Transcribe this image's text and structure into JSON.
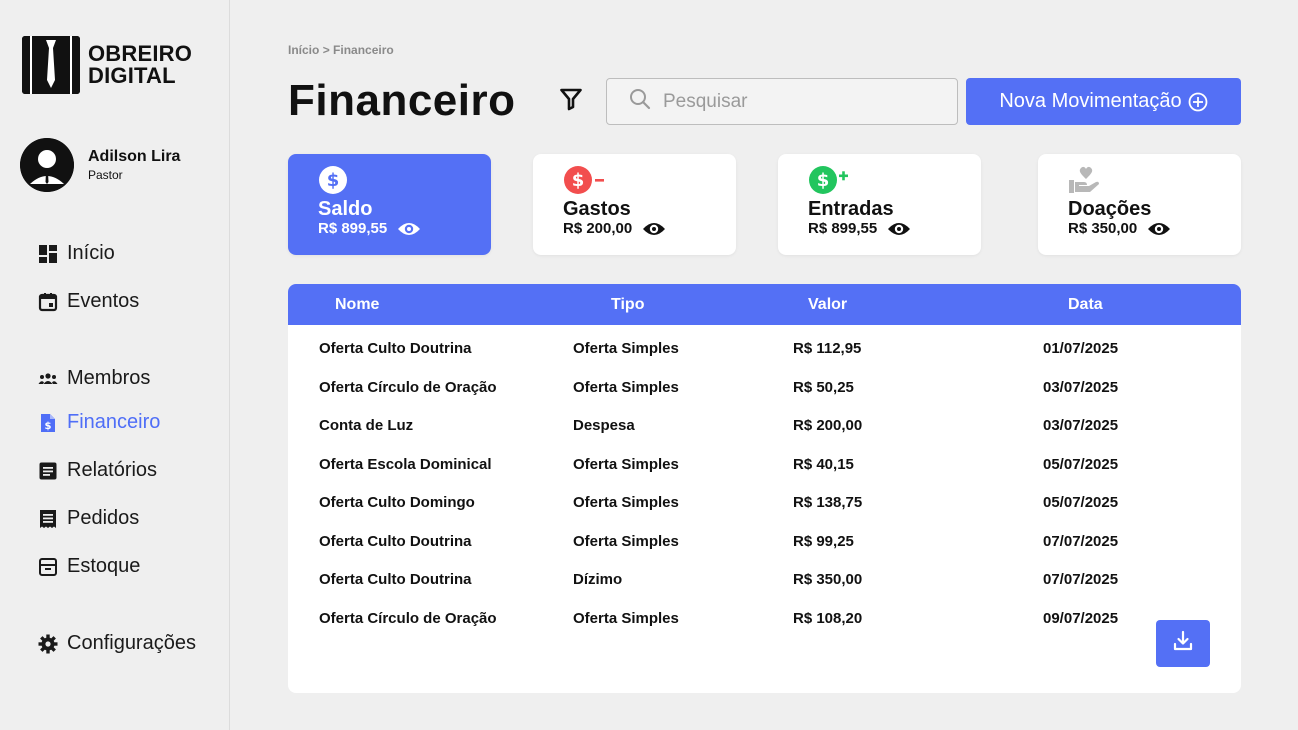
{
  "app": {
    "logo_line1": "OBREIRO",
    "logo_line2": "DIGITAL"
  },
  "user": {
    "name": "Adilson Lira",
    "role": "Pastor"
  },
  "sidebar": {
    "items": [
      {
        "label": "Início",
        "icon": "dashboard-icon"
      },
      {
        "label": "Eventos",
        "icon": "calendar-icon"
      },
      {
        "label": "Membros",
        "icon": "users-icon"
      },
      {
        "label": "Financeiro",
        "icon": "finance-doc-icon",
        "active": true
      },
      {
        "label": "Relatórios",
        "icon": "report-icon"
      },
      {
        "label": "Pedidos",
        "icon": "receipt-icon"
      },
      {
        "label": "Estoque",
        "icon": "archive-icon"
      },
      {
        "label": "Configurações",
        "icon": "gear-icon"
      }
    ]
  },
  "breadcrumb": {
    "home": "Início",
    "separator": ">",
    "current": "Financeiro"
  },
  "page": {
    "title": "Financeiro"
  },
  "search": {
    "placeholder": "Pesquisar",
    "value": ""
  },
  "actions": {
    "new_label": "Nova Movimentação"
  },
  "cards": [
    {
      "label": "Saldo",
      "value": "R$ 899,55",
      "icon": "dollar-icon"
    },
    {
      "label": "Gastos",
      "value": "R$ 200,00",
      "icon": "dollar-minus-icon"
    },
    {
      "label": "Entradas",
      "value": "R$ 899,55",
      "icon": "dollar-plus-icon"
    },
    {
      "label": "Doações",
      "value": "R$ 350,00",
      "icon": "donation-hand-icon"
    }
  ],
  "table": {
    "headers": [
      "Nome",
      "Tipo",
      "Valor",
      "Data"
    ],
    "rows": [
      [
        "Oferta Culto Doutrina",
        "Oferta Simples",
        "R$ 112,95",
        "01/07/2025"
      ],
      [
        "Oferta Círculo de Oração",
        "Oferta Simples",
        "R$ 50,25",
        "03/07/2025"
      ],
      [
        "Conta de Luz",
        "Despesa",
        "R$ 200,00",
        "03/07/2025"
      ],
      [
        "Oferta Escola Dominical",
        "Oferta Simples",
        "R$ 40,15",
        "05/07/2025"
      ],
      [
        "Oferta Culto Domingo",
        "Oferta Simples",
        "R$ 138,75",
        "05/07/2025"
      ],
      [
        "Oferta Culto Doutrina",
        "Oferta Simples",
        "R$ 99,25",
        "07/07/2025"
      ],
      [
        "Oferta Culto Doutrina",
        "Dízimo",
        "R$ 350,00",
        "07/07/2025"
      ],
      [
        "Oferta Círculo de Oração",
        "Oferta Simples",
        "R$ 108,20",
        "09/07/2025"
      ]
    ]
  },
  "colors": {
    "accent": "#5470f5",
    "active_nav": "#4f6ef7",
    "minus": "#f24e4e",
    "plus": "#22c55e"
  }
}
